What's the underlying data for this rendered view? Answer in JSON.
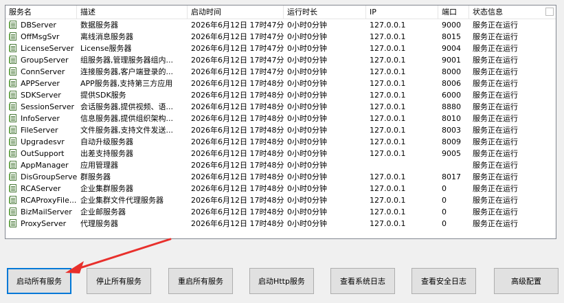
{
  "columns": [
    {
      "key": "name",
      "label": "服务名"
    },
    {
      "key": "desc",
      "label": "描述"
    },
    {
      "key": "start",
      "label": "启动时间"
    },
    {
      "key": "uptime",
      "label": "运行时长"
    },
    {
      "key": "ip",
      "label": "IP"
    },
    {
      "key": "port",
      "label": "端口"
    },
    {
      "key": "status",
      "label": "状态信息"
    }
  ],
  "rows": [
    {
      "name": "DBServer",
      "desc": "数据服务器",
      "start": "2026年6月12日 17时47分",
      "uptime": "0小时0分钟",
      "ip": "127.0.0.1",
      "port": "9000",
      "status": "服务正在运行"
    },
    {
      "name": "OffMsgSvr",
      "desc": "离线消息服务器",
      "start": "2026年6月12日 17时47分",
      "uptime": "0小时0分钟",
      "ip": "127.0.0.1",
      "port": "8015",
      "status": "服务正在运行"
    },
    {
      "name": "LicenseServer",
      "desc": "License服务器",
      "start": "2026年6月12日 17时47分",
      "uptime": "0小时0分钟",
      "ip": "127.0.0.1",
      "port": "9004",
      "status": "服务正在运行"
    },
    {
      "name": "GroupServer",
      "desc": "组服务器,管理服务器组内...",
      "start": "2026年6月12日 17时47分",
      "uptime": "0小时0分钟",
      "ip": "127.0.0.1",
      "port": "9001",
      "status": "服务正在运行"
    },
    {
      "name": "ConnServer",
      "desc": "连接服务器,客户端登录的...",
      "start": "2026年6月12日 17时47分",
      "uptime": "0小时0分钟",
      "ip": "127.0.0.1",
      "port": "8000",
      "status": "服务正在运行"
    },
    {
      "name": "APPServer",
      "desc": "APP服务器,支持第三方应用",
      "start": "2026年6月12日 17时48分",
      "uptime": "0小时0分钟",
      "ip": "127.0.0.1",
      "port": "8006",
      "status": "服务正在运行"
    },
    {
      "name": "SDKServer",
      "desc": "提供SDK服务",
      "start": "2026年6月12日 17时48分",
      "uptime": "0小时0分钟",
      "ip": "127.0.0.1",
      "port": "6000",
      "status": "服务正在运行"
    },
    {
      "name": "SessionServer",
      "desc": "会话服务器,提供视频、语...",
      "start": "2026年6月12日 17时48分",
      "uptime": "0小时0分钟",
      "ip": "127.0.0.1",
      "port": "8880",
      "status": "服务正在运行"
    },
    {
      "name": "InfoServer",
      "desc": "信息服务器,提供组织架构...",
      "start": "2026年6月12日 17时48分",
      "uptime": "0小时0分钟",
      "ip": "127.0.0.1",
      "port": "8010",
      "status": "服务正在运行"
    },
    {
      "name": "FileServer",
      "desc": "文件服务器,支持文件发送...",
      "start": "2026年6月12日 17时48分",
      "uptime": "0小时0分钟",
      "ip": "127.0.0.1",
      "port": "8003",
      "status": "服务正在运行"
    },
    {
      "name": "Upgradesvr",
      "desc": "自动升级服务器",
      "start": "2026年6月12日 17时48分",
      "uptime": "0小时0分钟",
      "ip": "127.0.0.1",
      "port": "8009",
      "status": "服务正在运行"
    },
    {
      "name": "OutSupport",
      "desc": "出差支持服务器",
      "start": "2026年6月12日 17时48分",
      "uptime": "0小时0分钟",
      "ip": "127.0.0.1",
      "port": "9005",
      "status": "服务正在运行"
    },
    {
      "name": "AppManager",
      "desc": "应用管理器",
      "start": "2026年6月12日 17时48分",
      "uptime": "0小时0分钟",
      "ip": "",
      "port": "",
      "status": "服务正在运行"
    },
    {
      "name": "DisGroupServer",
      "desc": "群服务器",
      "start": "2026年6月12日 17时48分",
      "uptime": "0小时0分钟",
      "ip": "127.0.0.1",
      "port": "8017",
      "status": "服务正在运行"
    },
    {
      "name": "RCAServer",
      "desc": "企业集群服务器",
      "start": "2026年6月12日 17时48分",
      "uptime": "0小时0分钟",
      "ip": "127.0.0.1",
      "port": "0",
      "status": "服务正在运行"
    },
    {
      "name": "RCAProxyFile...",
      "desc": "企业集群文件代理服务器",
      "start": "2026年6月12日 17时48分",
      "uptime": "0小时0分钟",
      "ip": "127.0.0.1",
      "port": "0",
      "status": "服务正在运行"
    },
    {
      "name": "BizMailServer",
      "desc": "企业邮服务器",
      "start": "2026年6月12日 17时48分",
      "uptime": "0小时0分钟",
      "ip": "127.0.0.1",
      "port": "0",
      "status": "服务正在运行"
    },
    {
      "name": "ProxyServer",
      "desc": "代理服务器",
      "start": "2026年6月12日 17时48分",
      "uptime": "0小时0分钟",
      "ip": "127.0.0.1",
      "port": "0",
      "status": "服务正在运行"
    }
  ],
  "buttons": [
    {
      "id": "start-all",
      "label": "启动所有服务"
    },
    {
      "id": "stop-all",
      "label": "停止所有服务"
    },
    {
      "id": "restart-all",
      "label": "重启所有服务"
    },
    {
      "id": "start-http",
      "label": "启动Http服务"
    },
    {
      "id": "system-log",
      "label": "查看系统日志"
    },
    {
      "id": "security-log",
      "label": "查看安全日志"
    },
    {
      "id": "advanced",
      "label": "高级配置"
    }
  ],
  "icons": {
    "row": "service-icon"
  },
  "colors": {
    "annotation_arrow": "#e8302c",
    "focus_border": "#0078d7"
  }
}
